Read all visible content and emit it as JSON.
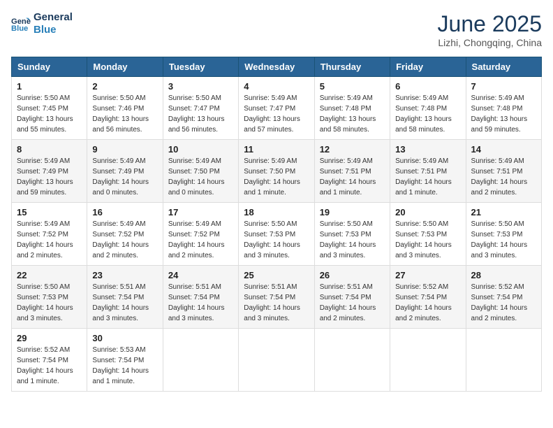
{
  "logo": {
    "line1": "General",
    "line2": "Blue"
  },
  "title": "June 2025",
  "subtitle": "Lizhi, Chongqing, China",
  "days_of_week": [
    "Sunday",
    "Monday",
    "Tuesday",
    "Wednesday",
    "Thursday",
    "Friday",
    "Saturday"
  ],
  "weeks": [
    [
      {
        "day": "1",
        "info": "Sunrise: 5:50 AM\nSunset: 7:45 PM\nDaylight: 13 hours\nand 55 minutes."
      },
      {
        "day": "2",
        "info": "Sunrise: 5:50 AM\nSunset: 7:46 PM\nDaylight: 13 hours\nand 56 minutes."
      },
      {
        "day": "3",
        "info": "Sunrise: 5:50 AM\nSunset: 7:47 PM\nDaylight: 13 hours\nand 56 minutes."
      },
      {
        "day": "4",
        "info": "Sunrise: 5:49 AM\nSunset: 7:47 PM\nDaylight: 13 hours\nand 57 minutes."
      },
      {
        "day": "5",
        "info": "Sunrise: 5:49 AM\nSunset: 7:48 PM\nDaylight: 13 hours\nand 58 minutes."
      },
      {
        "day": "6",
        "info": "Sunrise: 5:49 AM\nSunset: 7:48 PM\nDaylight: 13 hours\nand 58 minutes."
      },
      {
        "day": "7",
        "info": "Sunrise: 5:49 AM\nSunset: 7:48 PM\nDaylight: 13 hours\nand 59 minutes."
      }
    ],
    [
      {
        "day": "8",
        "info": "Sunrise: 5:49 AM\nSunset: 7:49 PM\nDaylight: 13 hours\nand 59 minutes."
      },
      {
        "day": "9",
        "info": "Sunrise: 5:49 AM\nSunset: 7:49 PM\nDaylight: 14 hours\nand 0 minutes."
      },
      {
        "day": "10",
        "info": "Sunrise: 5:49 AM\nSunset: 7:50 PM\nDaylight: 14 hours\nand 0 minutes."
      },
      {
        "day": "11",
        "info": "Sunrise: 5:49 AM\nSunset: 7:50 PM\nDaylight: 14 hours\nand 1 minute."
      },
      {
        "day": "12",
        "info": "Sunrise: 5:49 AM\nSunset: 7:51 PM\nDaylight: 14 hours\nand 1 minute."
      },
      {
        "day": "13",
        "info": "Sunrise: 5:49 AM\nSunset: 7:51 PM\nDaylight: 14 hours\nand 1 minute."
      },
      {
        "day": "14",
        "info": "Sunrise: 5:49 AM\nSunset: 7:51 PM\nDaylight: 14 hours\nand 2 minutes."
      }
    ],
    [
      {
        "day": "15",
        "info": "Sunrise: 5:49 AM\nSunset: 7:52 PM\nDaylight: 14 hours\nand 2 minutes."
      },
      {
        "day": "16",
        "info": "Sunrise: 5:49 AM\nSunset: 7:52 PM\nDaylight: 14 hours\nand 2 minutes."
      },
      {
        "day": "17",
        "info": "Sunrise: 5:49 AM\nSunset: 7:52 PM\nDaylight: 14 hours\nand 2 minutes."
      },
      {
        "day": "18",
        "info": "Sunrise: 5:50 AM\nSunset: 7:53 PM\nDaylight: 14 hours\nand 3 minutes."
      },
      {
        "day": "19",
        "info": "Sunrise: 5:50 AM\nSunset: 7:53 PM\nDaylight: 14 hours\nand 3 minutes."
      },
      {
        "day": "20",
        "info": "Sunrise: 5:50 AM\nSunset: 7:53 PM\nDaylight: 14 hours\nand 3 minutes."
      },
      {
        "day": "21",
        "info": "Sunrise: 5:50 AM\nSunset: 7:53 PM\nDaylight: 14 hours\nand 3 minutes."
      }
    ],
    [
      {
        "day": "22",
        "info": "Sunrise: 5:50 AM\nSunset: 7:53 PM\nDaylight: 14 hours\nand 3 minutes."
      },
      {
        "day": "23",
        "info": "Sunrise: 5:51 AM\nSunset: 7:54 PM\nDaylight: 14 hours\nand 3 minutes."
      },
      {
        "day": "24",
        "info": "Sunrise: 5:51 AM\nSunset: 7:54 PM\nDaylight: 14 hours\nand 3 minutes."
      },
      {
        "day": "25",
        "info": "Sunrise: 5:51 AM\nSunset: 7:54 PM\nDaylight: 14 hours\nand 3 minutes."
      },
      {
        "day": "26",
        "info": "Sunrise: 5:51 AM\nSunset: 7:54 PM\nDaylight: 14 hours\nand 2 minutes."
      },
      {
        "day": "27",
        "info": "Sunrise: 5:52 AM\nSunset: 7:54 PM\nDaylight: 14 hours\nand 2 minutes."
      },
      {
        "day": "28",
        "info": "Sunrise: 5:52 AM\nSunset: 7:54 PM\nDaylight: 14 hours\nand 2 minutes."
      }
    ],
    [
      {
        "day": "29",
        "info": "Sunrise: 5:52 AM\nSunset: 7:54 PM\nDaylight: 14 hours\nand 1 minute."
      },
      {
        "day": "30",
        "info": "Sunrise: 5:53 AM\nSunset: 7:54 PM\nDaylight: 14 hours\nand 1 minute."
      },
      {
        "day": "",
        "info": ""
      },
      {
        "day": "",
        "info": ""
      },
      {
        "day": "",
        "info": ""
      },
      {
        "day": "",
        "info": ""
      },
      {
        "day": "",
        "info": ""
      }
    ]
  ]
}
